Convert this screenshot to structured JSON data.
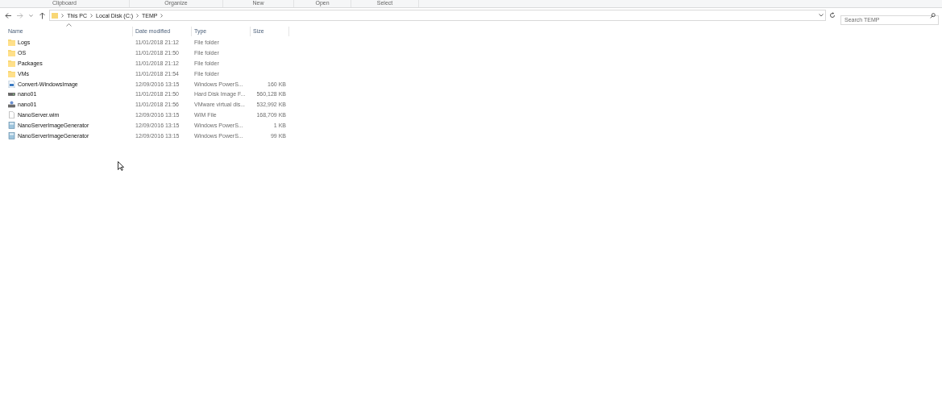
{
  "ribbon_groups": [
    "Clipboard",
    "Organize",
    "New",
    "Open",
    "Select"
  ],
  "address_bar": {
    "path": [
      "This PC",
      "Local Disk (C:)",
      "TEMP"
    ]
  },
  "search": {
    "placeholder": "Search TEMP"
  },
  "table": {
    "columns": [
      "Name",
      "Date modified",
      "Type",
      "Size"
    ],
    "rows": [
      {
        "kind": "folder",
        "name": "Logs",
        "date": "11/01/2018 21:12",
        "type": "File folder",
        "size": ""
      },
      {
        "kind": "folder",
        "name": "OS",
        "date": "11/01/2018 21:50",
        "type": "File folder",
        "size": ""
      },
      {
        "kind": "folder",
        "name": "Packages",
        "date": "11/01/2018 21:12",
        "type": "File folder",
        "size": ""
      },
      {
        "kind": "folder",
        "name": "VMs",
        "date": "11/01/2018 21:54",
        "type": "File folder",
        "size": ""
      },
      {
        "kind": "script",
        "name": "Convert-WindowsImage",
        "date": "12/09/2016 13:15",
        "type": "Windows PowerS...",
        "size": "160 KB"
      },
      {
        "kind": "disk",
        "name": "nano01",
        "date": "11/01/2018 21:50",
        "type": "Hard Disk Image F...",
        "size": "560,128 KB"
      },
      {
        "kind": "vmdisk",
        "name": "nano01",
        "date": "11/01/2018 21:56",
        "type": "VMware virtual dis...",
        "size": "532,992 KB"
      },
      {
        "kind": "file",
        "name": "NanoServer.wim",
        "date": "12/09/2016 13:15",
        "type": "WIM File",
        "size": "168,709 KB"
      },
      {
        "kind": "module",
        "name": "NanoServerImageGenerator",
        "date": "12/09/2016 13:15",
        "type": "Windows PowerS...",
        "size": "1 KB"
      },
      {
        "kind": "module",
        "name": "NanoServerImageGenerator",
        "date": "12/09/2016 13:15",
        "type": "Windows PowerS...",
        "size": "99 KB"
      }
    ]
  }
}
